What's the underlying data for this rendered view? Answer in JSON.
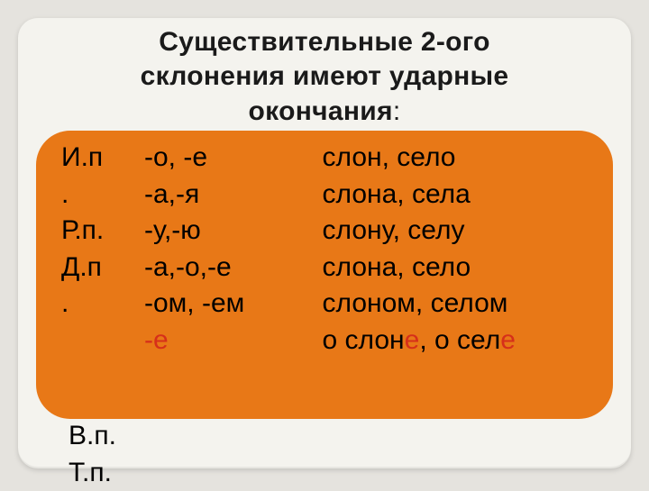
{
  "title_line1": "Существительные 2-ого",
  "title_line2": "склонения имеют ударные",
  "title_line3": "окончания",
  "title_colon": ":",
  "cases": {
    "c1a": "И.п",
    "c1b": ".",
    "c2": "Р.п.",
    "c3a": "Д.п",
    "c3b": ".",
    "c4": "В.п.",
    "c5": "Т.п."
  },
  "endings": {
    "e1": "-о, -е",
    "e2": "-а,-я",
    "e3": "-у,-ю",
    "e4": "-а,-о,-е",
    "e5": "-ом, -ем",
    "e6": "-е"
  },
  "examples": {
    "x1": "слон, село",
    "x2": "слона, села",
    "x3": "слону, селу",
    "x4": "слона, село",
    "x5": "слоном, селом",
    "x6a": "о слон",
    "x6b": "е",
    "x6c": ", о сел",
    "x6d": "е"
  }
}
